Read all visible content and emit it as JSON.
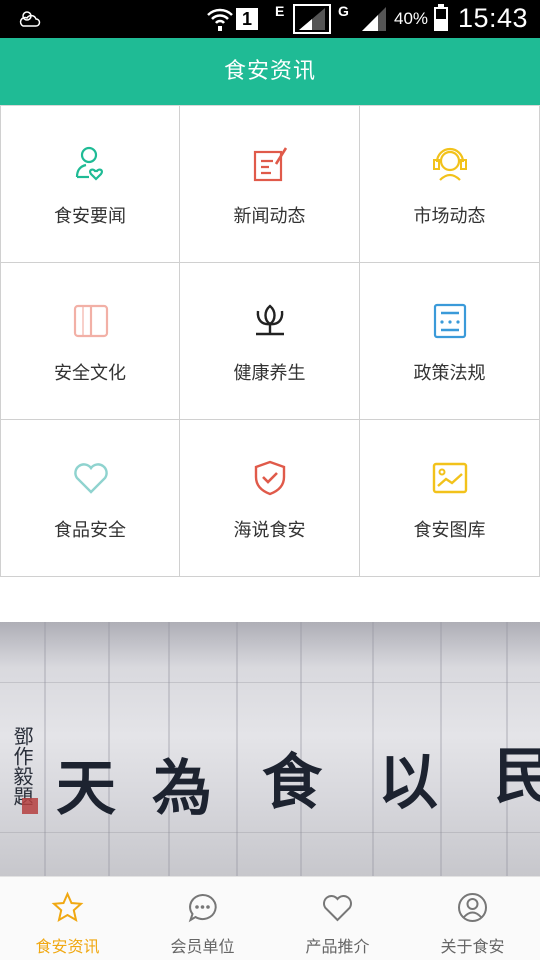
{
  "status_bar": {
    "sim_slot": "1",
    "network_1": "E",
    "network_2": "G",
    "battery": "40%",
    "time": "15:43"
  },
  "header": {
    "title": "食安资讯"
  },
  "grid": {
    "items": [
      {
        "label": "食安要闻",
        "icon": "person-heart-icon",
        "color": "#1fbb95"
      },
      {
        "label": "新闻动态",
        "icon": "edit-note-icon",
        "color": "#e05a4a"
      },
      {
        "label": "市场动态",
        "icon": "headset-person-icon",
        "color": "#f2c21b"
      },
      {
        "label": "安全文化",
        "icon": "open-book-icon",
        "color": "#f2b0a6"
      },
      {
        "label": "健康养生",
        "icon": "lotus-icon",
        "color": "#222222"
      },
      {
        "label": "政策法规",
        "icon": "document-list-icon",
        "color": "#3a9ad9"
      },
      {
        "label": "食品安全",
        "icon": "heart-outline-icon",
        "color": "#8fd3cf"
      },
      {
        "label": "海说食安",
        "icon": "shield-check-icon",
        "color": "#e05a4a"
      },
      {
        "label": "食安图库",
        "icon": "picture-chart-icon",
        "color": "#f2c21b"
      }
    ]
  },
  "banner": {
    "calligraphy": [
      "天",
      "為",
      "食",
      "以",
      "民"
    ],
    "inscription": "鄧作毅題"
  },
  "bottom_nav": {
    "items": [
      {
        "label": "食安资讯",
        "icon": "star-icon",
        "active": true
      },
      {
        "label": "会员单位",
        "icon": "chat-bubble-icon",
        "active": false
      },
      {
        "label": "产品推介",
        "icon": "heart-icon",
        "active": false
      },
      {
        "label": "关于食安",
        "icon": "user-circle-icon",
        "active": false
      }
    ],
    "active_color": "#f0a812",
    "inactive_color": "#666666"
  }
}
